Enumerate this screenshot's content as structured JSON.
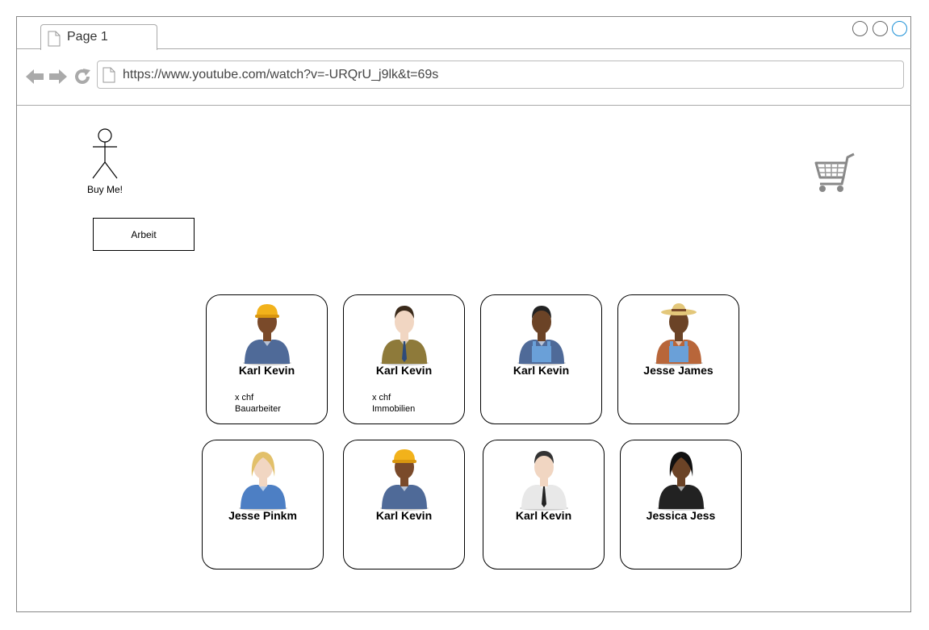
{
  "browser": {
    "tab_title": "Page 1",
    "url": "https://www.youtube.com/watch?v=-URQrU_j9lk&t=69s"
  },
  "header": {
    "logo_caption": "Buy Me!",
    "cart_icon": "shopping-cart-icon"
  },
  "filter": {
    "button_label": "Arbeit"
  },
  "colors": {
    "active_window_control": "#1a8fd6"
  },
  "cards": [
    {
      "name": "Karl Kevin",
      "price": "x chf",
      "job": "Bauarbeiter",
      "avatar": "construction-worker"
    },
    {
      "name": "Karl Kevin",
      "price": "x chf",
      "job": "Immobilien",
      "avatar": "businessman-brown-suit"
    },
    {
      "name": "Karl Kevin",
      "price": "",
      "job": "",
      "avatar": "worker-overalls"
    },
    {
      "name": "Jesse James",
      "price": "",
      "job": "",
      "avatar": "farmer-straw-hat"
    },
    {
      "name": "Jesse Pinkm",
      "price": "",
      "job": "",
      "avatar": "businesswoman-blonde"
    },
    {
      "name": "Karl Kevin",
      "price": "",
      "job": "",
      "avatar": "construction-worker"
    },
    {
      "name": "Karl Kevin",
      "price": "",
      "job": "",
      "avatar": "doctor-white-coat"
    },
    {
      "name": "Jessica Jess",
      "price": "",
      "job": "",
      "avatar": "businesswoman-black-suit"
    }
  ]
}
